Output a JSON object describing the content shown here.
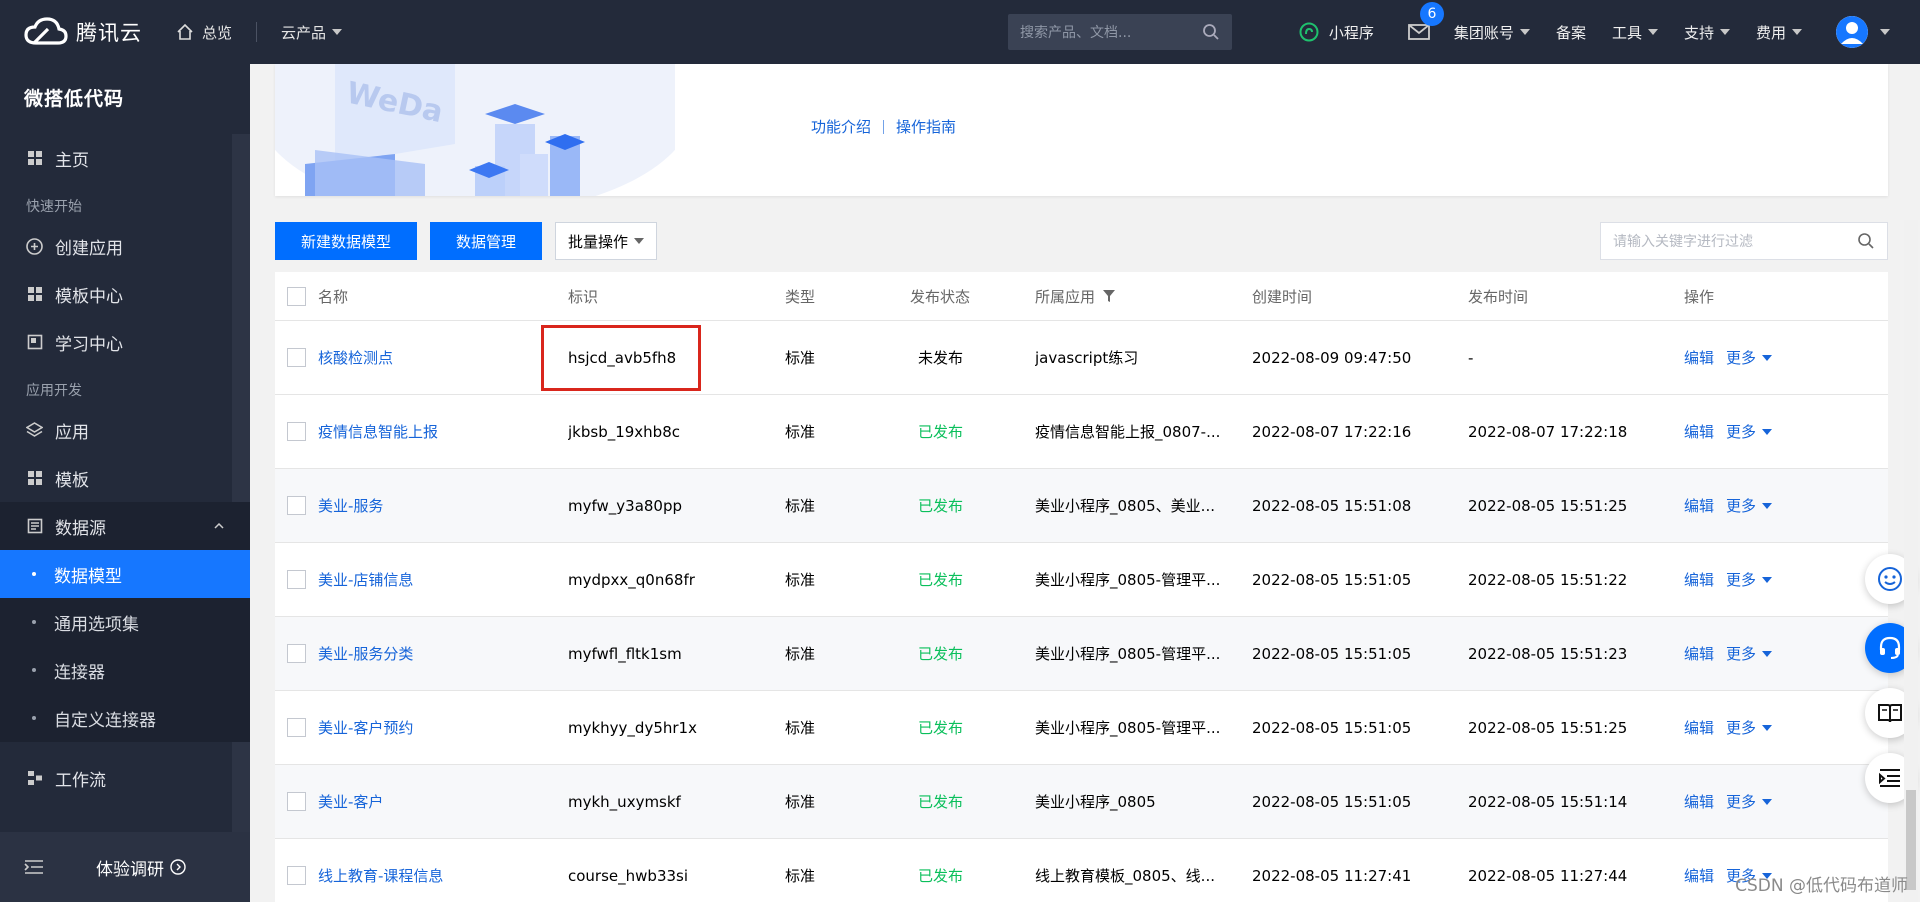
{
  "topbar": {
    "brand": "腾讯云",
    "home": "总览",
    "products": "云产品",
    "search_placeholder": "搜索产品、文档...",
    "miniprogram": "小程序",
    "message_count": "6",
    "menu": [
      "集团账号",
      "备案",
      "工具",
      "支持",
      "费用"
    ]
  },
  "sidebar": {
    "title": "微搭低代码",
    "home": "主页",
    "group_quick": "快速开始",
    "quick_items": [
      "创建应用",
      "模板中心",
      "学习中心"
    ],
    "group_dev": "应用开发",
    "dev_items": [
      "应用",
      "模板",
      "数据源"
    ],
    "datasource_sub": [
      "数据模型",
      "通用选项集",
      "连接器",
      "自定义连接器"
    ],
    "workflow": "工作流",
    "footer": "体验调研"
  },
  "banner": {
    "link1": "功能介绍",
    "link2": "操作指南",
    "art_text": "WeDa"
  },
  "toolbar": {
    "new_model": "新建数据模型",
    "data_manage": "数据管理",
    "batch": "批量操作",
    "filter_placeholder": "请输入关键字进行过滤"
  },
  "table": {
    "headers": [
      "名称",
      "标识",
      "类型",
      "发布状态",
      "所属应用",
      "创建时间",
      "发布时间",
      "操作"
    ],
    "edit_label": "编辑",
    "more_label": "更多",
    "rows": [
      {
        "name": "核酸检测点",
        "id": "hsjcd_avb5fh8",
        "type": "标准",
        "status": "未发布",
        "app": "javascript练习",
        "created": "2022-08-09 09:47:50",
        "published": "-"
      },
      {
        "name": "疫情信息智能上报",
        "id": "jkbsb_19xhb8c",
        "type": "标准",
        "status": "已发布",
        "app": "疫情信息智能上报_0807-...",
        "created": "2022-08-07 17:22:16",
        "published": "2022-08-07 17:22:18"
      },
      {
        "name": "美业-服务",
        "id": "myfw_y3a80pp",
        "type": "标准",
        "status": "已发布",
        "app": "美业小程序_0805、美业...",
        "created": "2022-08-05 15:51:08",
        "published": "2022-08-05 15:51:25"
      },
      {
        "name": "美业-店铺信息",
        "id": "mydpxx_q0n68fr",
        "type": "标准",
        "status": "已发布",
        "app": "美业小程序_0805-管理平...",
        "created": "2022-08-05 15:51:05",
        "published": "2022-08-05 15:51:22"
      },
      {
        "name": "美业-服务分类",
        "id": "myfwfl_fltk1sm",
        "type": "标准",
        "status": "已发布",
        "app": "美业小程序_0805-管理平...",
        "created": "2022-08-05 15:51:05",
        "published": "2022-08-05 15:51:23"
      },
      {
        "name": "美业-客户预约",
        "id": "mykhyy_dy5hr1x",
        "type": "标准",
        "status": "已发布",
        "app": "美业小程序_0805-管理平...",
        "created": "2022-08-05 15:51:05",
        "published": "2022-08-05 15:51:25"
      },
      {
        "name": "美业-客户",
        "id": "mykh_uxymskf",
        "type": "标准",
        "status": "已发布",
        "app": "美业小程序_0805",
        "created": "2022-08-05 15:51:05",
        "published": "2022-08-05 15:51:14"
      },
      {
        "name": "线上教育-课程信息",
        "id": "course_hwb33si",
        "type": "标准",
        "status": "已发布",
        "app": "线上教育模板_0805、线...",
        "created": "2022-08-05 11:27:41",
        "published": "2022-08-05 11:27:44"
      }
    ]
  },
  "watermark": "CSDN @低代码布道师",
  "colors": {
    "accent": "#006eff",
    "link": "#1664d9",
    "success": "#0abf5b",
    "nav_bg": "#232a3a",
    "highlight": "#d9261c"
  }
}
